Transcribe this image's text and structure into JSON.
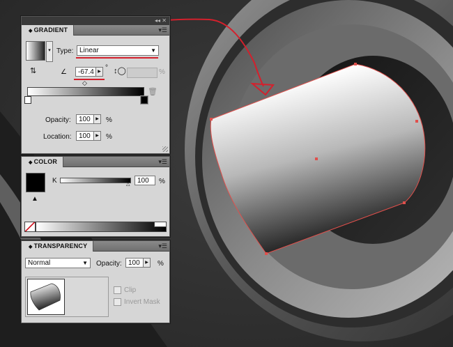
{
  "gradient_panel": {
    "title": "GRADIENT",
    "type_label": "Type:",
    "type_value": "Linear",
    "angle_value": "-67.4",
    "angle_unit": "°",
    "aspect_unit": "%",
    "opacity_label": "Opacity:",
    "opacity_value": "100",
    "opacity_unit": "%",
    "location_label": "Location:",
    "location_value": "100",
    "location_unit": "%"
  },
  "color_panel": {
    "title": "COLOR",
    "channel_label": "K",
    "channel_value": "100",
    "channel_unit": "%",
    "k_level": 1.0
  },
  "transparency_panel": {
    "title": "TRANSPARENCY",
    "blend_mode": "Normal",
    "opacity_label": "Opacity:",
    "opacity_value": "100",
    "opacity_unit": "%",
    "clip_label": "Clip",
    "invert_mask_label": "Invert Mask"
  },
  "icons": {
    "collapse": "double-chevron-icon",
    "panel_menu": "panel-menu-icon",
    "angle": "angle-icon",
    "aspect": "aspect-ratio-icon",
    "trash": "trash-icon",
    "reverse": "reverse-gradient-icon"
  },
  "colors": {
    "annotation": "#d4202c",
    "selection": "#e0504c",
    "panel_bg": "#d6d6d6"
  }
}
